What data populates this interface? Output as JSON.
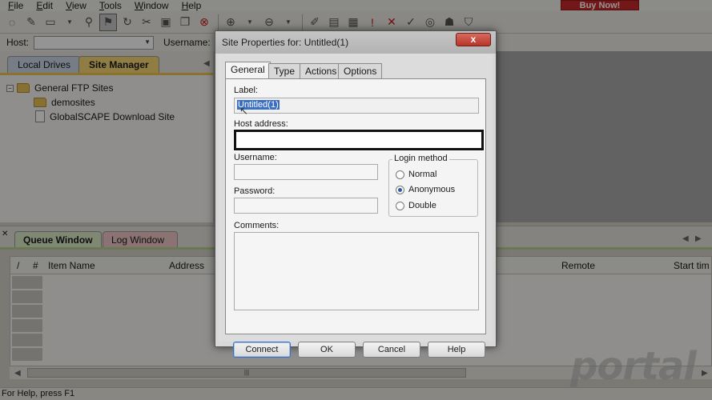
{
  "menu": {
    "items": [
      "File",
      "Edit",
      "View",
      "Tools",
      "Window",
      "Help"
    ],
    "buy_now": "Buy Now!"
  },
  "toolbar": {
    "icons": [
      "connect-wizard-icon",
      "quick-connect-icon",
      "new-icon",
      "connect-icon",
      "disconnect-icon",
      "site-manager-icon",
      "refresh-icon",
      "stop-icon",
      "download-icon",
      "upload-icon",
      "edit-icon",
      "delete-icon",
      "permissions-icon",
      "bookmark-icon"
    ]
  },
  "connbar": {
    "host_label": "Host:",
    "username_label": "Username:"
  },
  "left_panel": {
    "tabs": [
      "Local Drives",
      "Site Manager"
    ],
    "tree": {
      "root": "General FTP Sites",
      "children": [
        "demosites",
        "GlobalSCAPE Download Site"
      ]
    }
  },
  "queue": {
    "tabs": [
      "Queue Window",
      "Log Window"
    ],
    "columns": [
      "/",
      "#",
      "Item Name",
      "Address",
      "Remote",
      "Start tim"
    ]
  },
  "statusbar": {
    "text": "For Help, press F1"
  },
  "watermark": {
    "text": "portal"
  },
  "dialog": {
    "title": "Site Properties for: Untitled(1)",
    "close": "x",
    "tabs": [
      "General",
      "Type",
      "Actions",
      "Options"
    ],
    "active_tab": "General",
    "label_label": "Label:",
    "label_value": "Untitled(1)",
    "host_label": "Host address:",
    "host_value": "",
    "username_label": "Username:",
    "username_value": "",
    "password_label": "Password:",
    "password_value": "",
    "login_method_label": "Login method",
    "login_methods": [
      "Normal",
      "Anonymous",
      "Double"
    ],
    "selected_login_method": "Anonymous",
    "comments_label": "Comments:",
    "comments_value": "",
    "buttons": {
      "connect": "Connect",
      "ok": "OK",
      "cancel": "Cancel",
      "help": "Help"
    }
  }
}
